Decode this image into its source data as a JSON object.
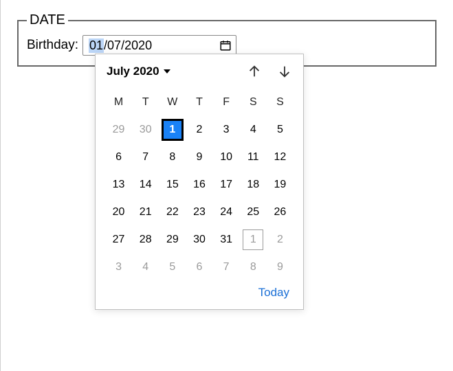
{
  "fieldset": {
    "legend": "DATE"
  },
  "input": {
    "label": "Birthday:",
    "day": "01",
    "sep": "/",
    "month": "07",
    "year": "2020"
  },
  "picker": {
    "month_label": "July 2020",
    "today_label": "Today",
    "weekdays": [
      "M",
      "T",
      "W",
      "T",
      "F",
      "S",
      "S"
    ],
    "rows": [
      [
        {
          "n": 29,
          "other": true
        },
        {
          "n": 30,
          "other": true
        },
        {
          "n": 1,
          "sel": true
        },
        {
          "n": 2
        },
        {
          "n": 3
        },
        {
          "n": 4
        },
        {
          "n": 5
        }
      ],
      [
        {
          "n": 6
        },
        {
          "n": 7
        },
        {
          "n": 8
        },
        {
          "n": 9
        },
        {
          "n": 10
        },
        {
          "n": 11
        },
        {
          "n": 12
        }
      ],
      [
        {
          "n": 13
        },
        {
          "n": 14
        },
        {
          "n": 15
        },
        {
          "n": 16
        },
        {
          "n": 17
        },
        {
          "n": 18
        },
        {
          "n": 19
        }
      ],
      [
        {
          "n": 20
        },
        {
          "n": 21
        },
        {
          "n": 22
        },
        {
          "n": 23
        },
        {
          "n": 24
        },
        {
          "n": 25
        },
        {
          "n": 26
        }
      ],
      [
        {
          "n": 27
        },
        {
          "n": 28
        },
        {
          "n": 29
        },
        {
          "n": 30
        },
        {
          "n": 31
        },
        {
          "n": 1,
          "other": true,
          "outline": true
        },
        {
          "n": 2,
          "other": true
        }
      ],
      [
        {
          "n": 3,
          "other": true
        },
        {
          "n": 4,
          "other": true
        },
        {
          "n": 5,
          "other": true
        },
        {
          "n": 6,
          "other": true
        },
        {
          "n": 7,
          "other": true
        },
        {
          "n": 8,
          "other": true
        },
        {
          "n": 9,
          "other": true
        }
      ]
    ]
  }
}
